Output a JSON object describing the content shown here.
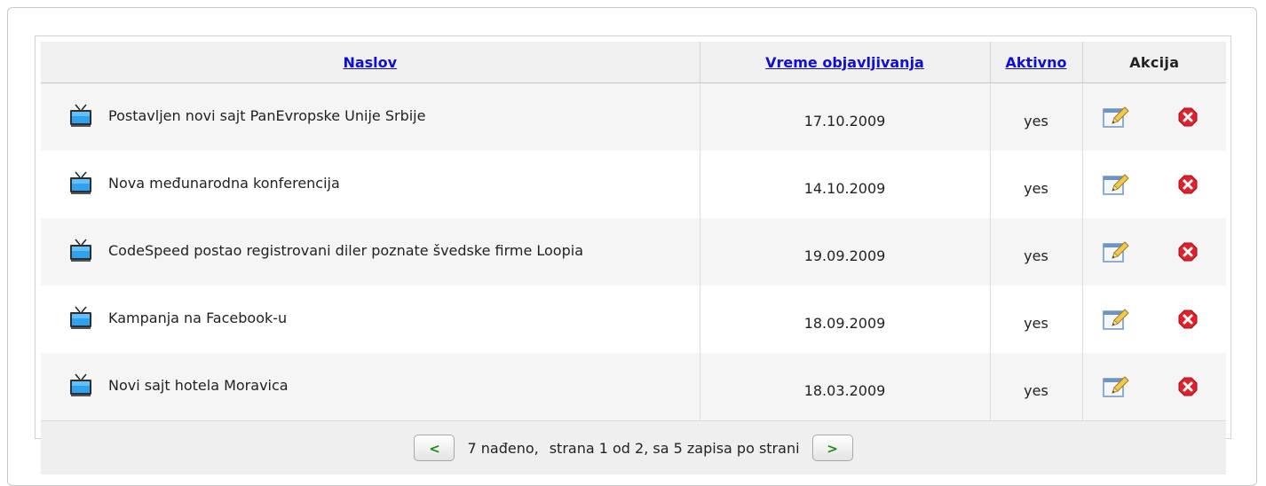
{
  "columns": {
    "title": "Naslov",
    "date": "Vreme objavljivanja",
    "active": "Aktivno",
    "action": "Akcija"
  },
  "rows": [
    {
      "title": "Postavljen novi sajt PanEvropske Unije Srbije",
      "date": "17.10.2009",
      "active": "yes"
    },
    {
      "title": "Nova međunarodna konferencija",
      "date": "14.10.2009",
      "active": "yes"
    },
    {
      "title": "CodeSpeed postao registrovani diler poznate švedske firme Loopia",
      "date": "19.09.2009",
      "active": "yes"
    },
    {
      "title": "Kampanja na Facebook-u",
      "date": "18.09.2009",
      "active": "yes"
    },
    {
      "title": "Novi sajt hotela Moravica",
      "date": "18.03.2009",
      "active": "yes"
    }
  ],
  "pager": {
    "prev_label": "<",
    "next_label": ">",
    "found_text": "7 nađeno,",
    "page_text": "strana 1 od 2, sa 5 zapisa po strani"
  },
  "icons": {
    "row": "tv-icon",
    "edit": "edit-icon",
    "delete": "delete-icon"
  },
  "colors": {
    "link": "#0f0fd0",
    "delete_red": "#e0202a",
    "pager_arrow": "#1a8a1a"
  }
}
